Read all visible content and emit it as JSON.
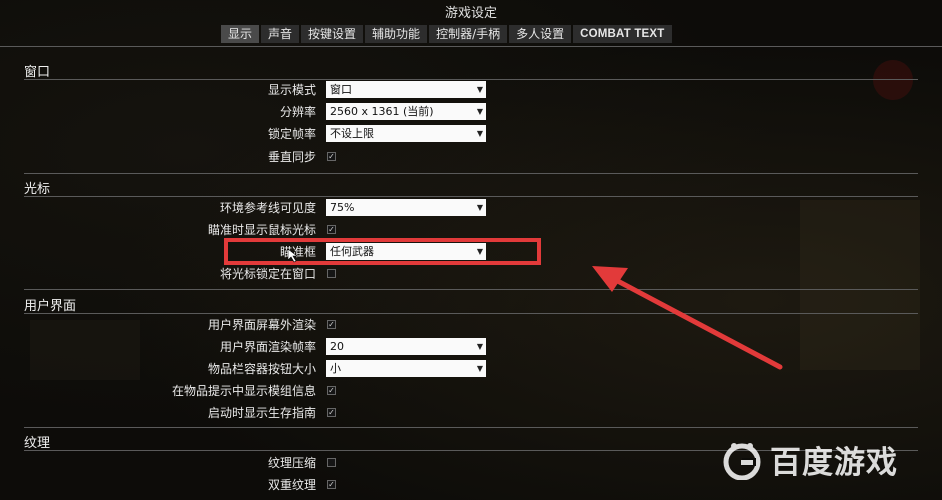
{
  "window": {
    "title": "游戏设定"
  },
  "tabs": [
    {
      "label": "显示",
      "active": true
    },
    {
      "label": "声音",
      "active": false
    },
    {
      "label": "按键设置",
      "active": false
    },
    {
      "label": "辅助功能",
      "active": false
    },
    {
      "label": "控制器/手柄",
      "active": false
    },
    {
      "label": "多人设置",
      "active": false
    },
    {
      "label": "COMBAT TEXT",
      "active": false
    }
  ],
  "sections": {
    "window": {
      "title": "窗口",
      "display_mode": {
        "label": "显示模式",
        "value": "窗口"
      },
      "resolution": {
        "label": "分辨率",
        "value": "2560 x 1361 (当前)"
      },
      "frame_lock": {
        "label": "锁定帧率",
        "value": "不设上限"
      },
      "vsync": {
        "label": "垂直同步",
        "checked": true
      }
    },
    "cursor": {
      "title": "光标",
      "guideline_visibility": {
        "label": "环境参考线可见度",
        "value": "75%"
      },
      "show_cursor_aiming": {
        "label": "瞄准时显示鼠标光标",
        "checked": true
      },
      "reticle": {
        "label": "瞄准框",
        "value": "任何武器"
      },
      "lock_cursor_window": {
        "label": "将光标锁定在窗口",
        "checked": false
      }
    },
    "ui": {
      "title": "用户界面",
      "offscreen_render": {
        "label": "用户界面屏幕外渲染",
        "checked": true
      },
      "ui_frame_rate": {
        "label": "用户界面渲染帧率",
        "value": "20"
      },
      "container_button_size": {
        "label": "物品栏容器按钮大小",
        "value": "小"
      },
      "show_mod_info": {
        "label": "在物品提示中显示模组信息",
        "checked": true
      },
      "show_survival_guide": {
        "label": "启动时显示生存指南",
        "checked": true
      }
    },
    "texture": {
      "title": "纹理",
      "texture_compression": {
        "label": "纹理压缩",
        "checked": false
      },
      "double_texture": {
        "label": "双重纹理",
        "checked": true
      }
    }
  },
  "watermark": {
    "text": "百度游戏"
  },
  "colors": {
    "highlight": "#e23a3a",
    "panel": "#2d2d2d",
    "active_tab": "#4a4a4a"
  }
}
